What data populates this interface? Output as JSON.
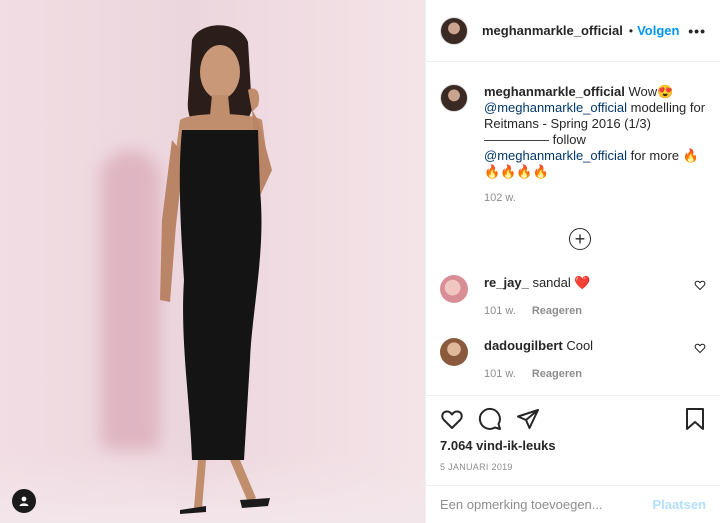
{
  "header": {
    "username": "meghanmarkle_official",
    "separator": "•",
    "follow_label": "Volgen",
    "more_label": "•••"
  },
  "caption": {
    "username": "meghanmarkle_official",
    "text_1": " Wow😍 ",
    "mention_1": "@meghanmarkle_official",
    "text_2": " modelling for Reitmans - Spring 2016 (1/3) ————— follow ",
    "mention_2": "@meghanmarkle_official",
    "text_3": " for more 🔥🔥🔥🔥🔥",
    "time": "102 w."
  },
  "load_more_label": "+",
  "comments": [
    {
      "username": "re_jay_",
      "text": " sandal ❤️",
      "time": "101 w.",
      "reply_label": "Reageren"
    },
    {
      "username": "dadougilbert",
      "text": " Cool",
      "time": "101 w.",
      "reply_label": "Reageren"
    }
  ],
  "likes": "7.064 vind-ik-leuks",
  "date": "5 JANUARI 2019",
  "add_comment": {
    "placeholder": "Een opmerking toevoegen...",
    "post_label": "Plaatsen"
  },
  "icons": {
    "like": "heart-icon",
    "comment": "comment-icon",
    "share": "paper-plane-icon",
    "save": "bookmark-icon",
    "tag": "user-tag-icon"
  },
  "colors": {
    "accent": "#0095f6",
    "mention": "#00376b",
    "muted": "#8e8e8e",
    "post_disabled": "#b2dffc"
  }
}
